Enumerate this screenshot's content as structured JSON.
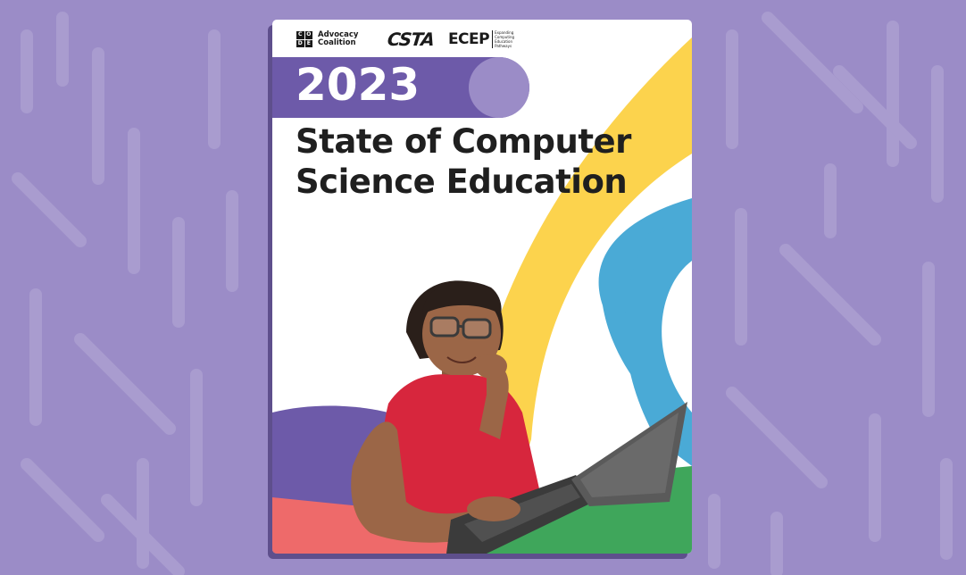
{
  "logos": {
    "code_letters": [
      "C",
      "O",
      "D",
      "E"
    ],
    "code_name_line1": "Advocacy",
    "code_name_line2": "Coalition",
    "csta": "CSTA",
    "ecep_mark": "ECEP",
    "ecep_sub": "Expanding Computing Education Pathways"
  },
  "cover": {
    "year": "2023",
    "title_line1": "State of Computer",
    "title_line2": "Science Education"
  },
  "colors": {
    "background": "#9b8cc7",
    "purple": "#6d5aa9",
    "yellow": "#fcd34d",
    "blue": "#4aaad6",
    "green": "#3fa65b",
    "coral": "#ee6a6a"
  },
  "image": {
    "subject_icon": "student-with-laptop-illustration"
  }
}
